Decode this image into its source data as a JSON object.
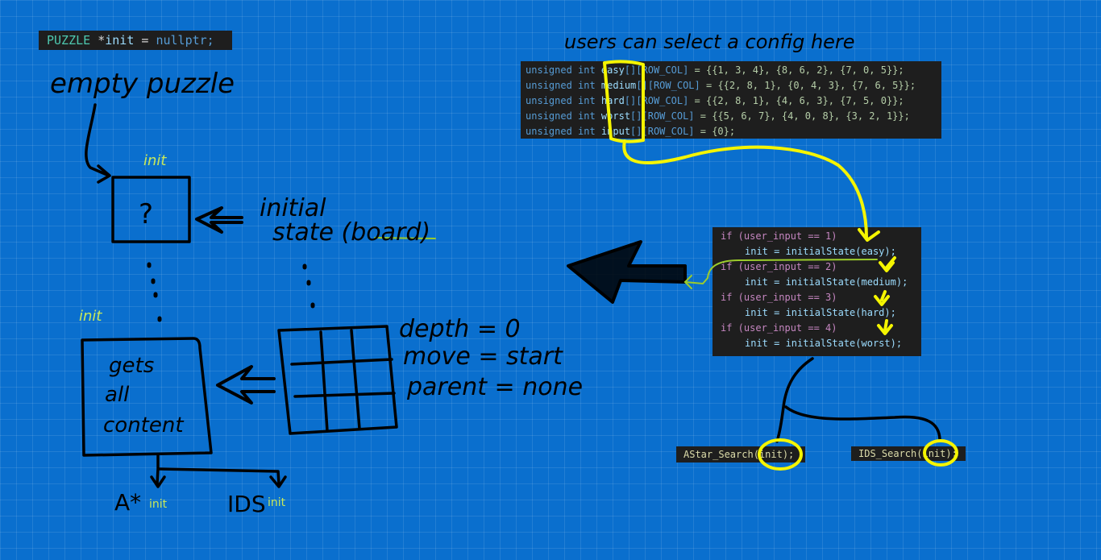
{
  "code_decl": {
    "type": "PUZZLE",
    "ptr": "*",
    "name": "init",
    "assign": "=",
    "value": "nullptr;"
  },
  "arrays": [
    {
      "prefix": "unsigned int ",
      "name": "easy",
      "dims": "[][ROW_COL]",
      "init": " = {{1, 3, 4}, {8, 6, 2}, {7, 0, 5}};"
    },
    {
      "prefix": "unsigned int ",
      "name": "medium",
      "dims": "[][ROW_COL]",
      "init": " = {{2, 8, 1}, {0, 4, 3}, {7, 6, 5}};"
    },
    {
      "prefix": "unsigned int ",
      "name": "hard",
      "dims": "[][ROW_COL]",
      "init": " = {{2, 8, 1}, {4, 6, 3}, {7, 5, 0}};"
    },
    {
      "prefix": "unsigned int ",
      "name": "worst",
      "dims": "[][ROW_COL]",
      "init": " = {{5, 6, 7}, {4, 0, 8}, {3, 2, 1}};"
    },
    {
      "prefix": "unsigned int ",
      "name": "input",
      "dims": "[][ROW_COL]",
      "init": " = {0};"
    }
  ],
  "conditions": [
    {
      "cond": "if (user_input == 1)",
      "body": "init = initialState(easy);"
    },
    {
      "cond": "if (user_input == 2)",
      "body": "init = initialState(medium);"
    },
    {
      "cond": "if (user_input == 3)",
      "body": "init = initialState(hard);"
    },
    {
      "cond": "if (user_input == 4)",
      "body": "init = initialState(worst);"
    }
  ],
  "astar_call": "AStar_Search(init);",
  "ids_call": "IDS_Search(init);",
  "annotations": {
    "users_select": "users can select a config here",
    "empty_puzzle": "empty puzzle",
    "init_label_1": "init",
    "init_label_2": "init",
    "question": "?",
    "initial_state": "initial",
    "initial_state_2": "state (board)",
    "gets": "gets",
    "all": "all",
    "content": "content",
    "depth": "depth = 0",
    "move": "move = start",
    "parent": "parent = none",
    "astar_label": "A*",
    "ids_label": "IDS",
    "init_small_1": "init",
    "init_small_2": "init"
  },
  "colors": {
    "background": "#0a6fce",
    "ink": "#000000",
    "highlight": "#f5f500",
    "green_ink": "#9ccc2c"
  }
}
